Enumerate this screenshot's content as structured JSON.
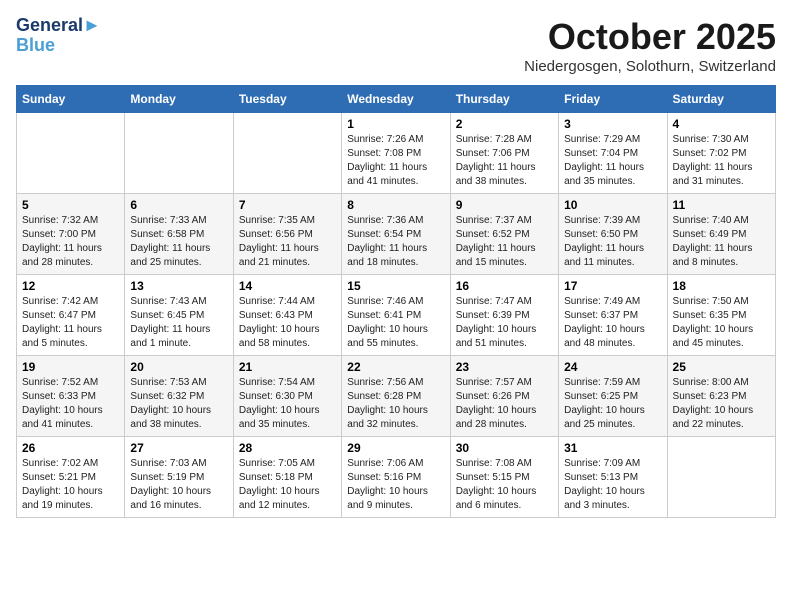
{
  "header": {
    "logo_line1": "General",
    "logo_line2": "Blue",
    "month": "October 2025",
    "location": "Niedergosgen, Solothurn, Switzerland"
  },
  "weekdays": [
    "Sunday",
    "Monday",
    "Tuesday",
    "Wednesday",
    "Thursday",
    "Friday",
    "Saturday"
  ],
  "weeks": [
    [
      {
        "day": "",
        "info": ""
      },
      {
        "day": "",
        "info": ""
      },
      {
        "day": "",
        "info": ""
      },
      {
        "day": "1",
        "info": "Sunrise: 7:26 AM\nSunset: 7:08 PM\nDaylight: 11 hours\nand 41 minutes."
      },
      {
        "day": "2",
        "info": "Sunrise: 7:28 AM\nSunset: 7:06 PM\nDaylight: 11 hours\nand 38 minutes."
      },
      {
        "day": "3",
        "info": "Sunrise: 7:29 AM\nSunset: 7:04 PM\nDaylight: 11 hours\nand 35 minutes."
      },
      {
        "day": "4",
        "info": "Sunrise: 7:30 AM\nSunset: 7:02 PM\nDaylight: 11 hours\nand 31 minutes."
      }
    ],
    [
      {
        "day": "5",
        "info": "Sunrise: 7:32 AM\nSunset: 7:00 PM\nDaylight: 11 hours\nand 28 minutes."
      },
      {
        "day": "6",
        "info": "Sunrise: 7:33 AM\nSunset: 6:58 PM\nDaylight: 11 hours\nand 25 minutes."
      },
      {
        "day": "7",
        "info": "Sunrise: 7:35 AM\nSunset: 6:56 PM\nDaylight: 11 hours\nand 21 minutes."
      },
      {
        "day": "8",
        "info": "Sunrise: 7:36 AM\nSunset: 6:54 PM\nDaylight: 11 hours\nand 18 minutes."
      },
      {
        "day": "9",
        "info": "Sunrise: 7:37 AM\nSunset: 6:52 PM\nDaylight: 11 hours\nand 15 minutes."
      },
      {
        "day": "10",
        "info": "Sunrise: 7:39 AM\nSunset: 6:50 PM\nDaylight: 11 hours\nand 11 minutes."
      },
      {
        "day": "11",
        "info": "Sunrise: 7:40 AM\nSunset: 6:49 PM\nDaylight: 11 hours\nand 8 minutes."
      }
    ],
    [
      {
        "day": "12",
        "info": "Sunrise: 7:42 AM\nSunset: 6:47 PM\nDaylight: 11 hours\nand 5 minutes."
      },
      {
        "day": "13",
        "info": "Sunrise: 7:43 AM\nSunset: 6:45 PM\nDaylight: 11 hours\nand 1 minute."
      },
      {
        "day": "14",
        "info": "Sunrise: 7:44 AM\nSunset: 6:43 PM\nDaylight: 10 hours\nand 58 minutes."
      },
      {
        "day": "15",
        "info": "Sunrise: 7:46 AM\nSunset: 6:41 PM\nDaylight: 10 hours\nand 55 minutes."
      },
      {
        "day": "16",
        "info": "Sunrise: 7:47 AM\nSunset: 6:39 PM\nDaylight: 10 hours\nand 51 minutes."
      },
      {
        "day": "17",
        "info": "Sunrise: 7:49 AM\nSunset: 6:37 PM\nDaylight: 10 hours\nand 48 minutes."
      },
      {
        "day": "18",
        "info": "Sunrise: 7:50 AM\nSunset: 6:35 PM\nDaylight: 10 hours\nand 45 minutes."
      }
    ],
    [
      {
        "day": "19",
        "info": "Sunrise: 7:52 AM\nSunset: 6:33 PM\nDaylight: 10 hours\nand 41 minutes."
      },
      {
        "day": "20",
        "info": "Sunrise: 7:53 AM\nSunset: 6:32 PM\nDaylight: 10 hours\nand 38 minutes."
      },
      {
        "day": "21",
        "info": "Sunrise: 7:54 AM\nSunset: 6:30 PM\nDaylight: 10 hours\nand 35 minutes."
      },
      {
        "day": "22",
        "info": "Sunrise: 7:56 AM\nSunset: 6:28 PM\nDaylight: 10 hours\nand 32 minutes."
      },
      {
        "day": "23",
        "info": "Sunrise: 7:57 AM\nSunset: 6:26 PM\nDaylight: 10 hours\nand 28 minutes."
      },
      {
        "day": "24",
        "info": "Sunrise: 7:59 AM\nSunset: 6:25 PM\nDaylight: 10 hours\nand 25 minutes."
      },
      {
        "day": "25",
        "info": "Sunrise: 8:00 AM\nSunset: 6:23 PM\nDaylight: 10 hours\nand 22 minutes."
      }
    ],
    [
      {
        "day": "26",
        "info": "Sunrise: 7:02 AM\nSunset: 5:21 PM\nDaylight: 10 hours\nand 19 minutes."
      },
      {
        "day": "27",
        "info": "Sunrise: 7:03 AM\nSunset: 5:19 PM\nDaylight: 10 hours\nand 16 minutes."
      },
      {
        "day": "28",
        "info": "Sunrise: 7:05 AM\nSunset: 5:18 PM\nDaylight: 10 hours\nand 12 minutes."
      },
      {
        "day": "29",
        "info": "Sunrise: 7:06 AM\nSunset: 5:16 PM\nDaylight: 10 hours\nand 9 minutes."
      },
      {
        "day": "30",
        "info": "Sunrise: 7:08 AM\nSunset: 5:15 PM\nDaylight: 10 hours\nand 6 minutes."
      },
      {
        "day": "31",
        "info": "Sunrise: 7:09 AM\nSunset: 5:13 PM\nDaylight: 10 hours\nand 3 minutes."
      },
      {
        "day": "",
        "info": ""
      }
    ]
  ]
}
